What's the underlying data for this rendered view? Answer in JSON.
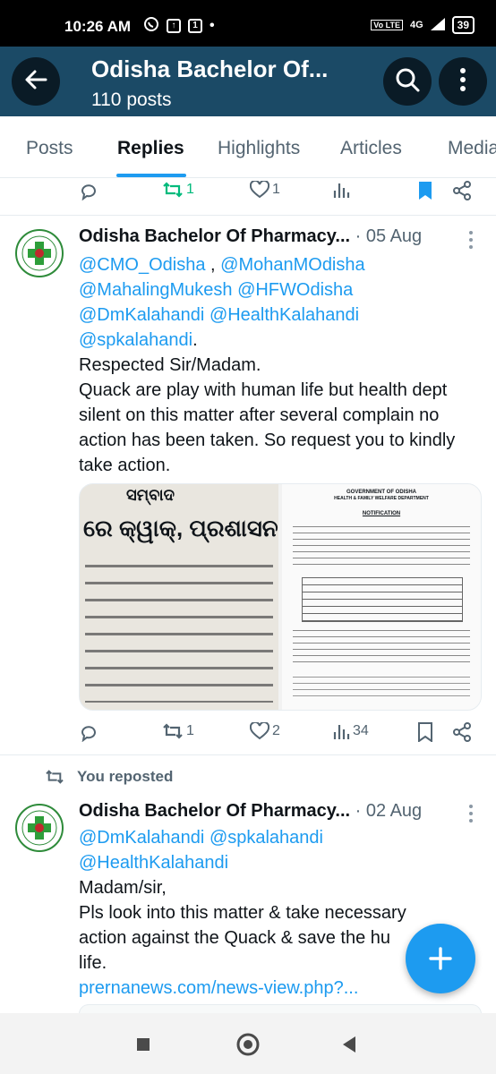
{
  "status_bar": {
    "time": "10:26 AM",
    "network": "4G",
    "volte": "Vo LTE",
    "battery": "39"
  },
  "header": {
    "title": "Odisha Bachelor Of...",
    "posts_count": "110 posts"
  },
  "tabs": [
    {
      "label": "Posts"
    },
    {
      "label": "Replies",
      "active": true
    },
    {
      "label": "Highlights"
    },
    {
      "label": "Articles"
    },
    {
      "label": "Media"
    }
  ],
  "top_actions": {
    "retweets": "1",
    "likes": "1"
  },
  "post1": {
    "author": "Odisha Bachelor Of Pharmacy...",
    "separator": "·",
    "date": "05 Aug",
    "mention_cmo": "@CMO_Odisha",
    "comma_sep": " , ",
    "mention_mohan": "@MohanMOdisha",
    "mention_mahaling": "@MahalingMukesh",
    "mention_hfw": "@HFWOdisha",
    "mention_dm": "@DmKalahandi",
    "mention_health": "@HealthKalahandi",
    "mention_sp": "@spkalahandi",
    "period": ".",
    "line1": "Respected Sir/Madam.",
    "line2": "Quack are play with human life but health dept silent on this matter after several complain no action has been taken. So request you to kindly take action.",
    "media": {
      "newspaper_masthead": "ସମ୍ବାଦ",
      "newspaper_headline": "ରେ କ୍ୱାକ୍, ପ୍ରଶାସନର ଲଗା",
      "notification_title": "NOTIFICATION",
      "notification_dept": "GOVERNMENT OF ODISHA",
      "notification_subdept": "HEALTH & FAMILY WELFARE DEPARTMENT"
    },
    "stats": {
      "retweets": "1",
      "likes": "2",
      "views": "34"
    }
  },
  "post2": {
    "repost_label": "You reposted",
    "author": "Odisha Bachelor Of Pharmacy...",
    "separator": "·",
    "date": "02 Aug",
    "mention_dm": "@DmKalahandi",
    "mention_sp": "@spkalahandi",
    "mention_health": "@HealthKalahandi",
    "line1": "Madam/sir,",
    "line2": "Pls look into this matter & take necessary action against the Quack & save the hu",
    "line2b": "life.",
    "link": "prernanews.com/news-view.php?..."
  },
  "colors": {
    "accent": "#1d9bf0",
    "header_bg": "#1b4a66",
    "retweet_green": "#00ba7c"
  },
  "icons": [
    "back-arrow-icon",
    "search-icon",
    "more-vertical-icon",
    "reply-icon",
    "retweet-icon",
    "like-icon",
    "views-icon",
    "bookmark-icon",
    "share-icon",
    "repost-icon",
    "plus-icon"
  ]
}
